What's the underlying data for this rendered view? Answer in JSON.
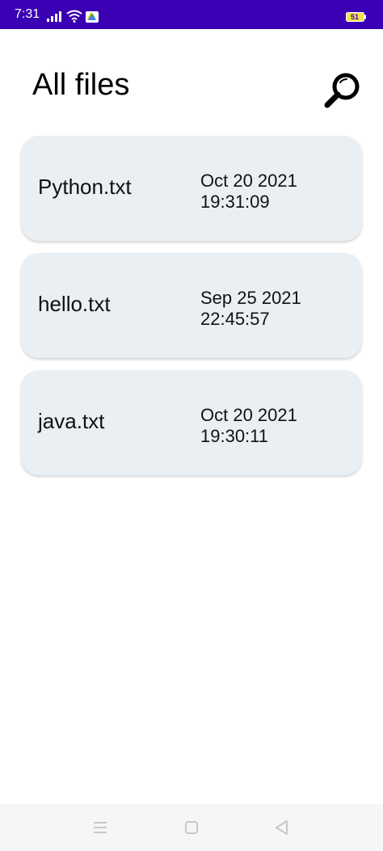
{
  "status_bar": {
    "time": "7:31",
    "battery": "51",
    "icons": [
      "signal-icon",
      "wifi-icon",
      "drive-icon",
      "battery-icon"
    ],
    "background": "#3b00b3"
  },
  "header": {
    "title": "All files",
    "search_icon": "search-icon"
  },
  "files": [
    {
      "name": "Python.txt",
      "date": "Oct 20 2021",
      "time": "19:31:09"
    },
    {
      "name": "hello.txt",
      "date": "Sep 25 2021",
      "time": "22:45:57"
    },
    {
      "name": "java.txt",
      "date": "Oct 20 2021",
      "time": "19:30:11"
    }
  ],
  "nav_bar": {
    "icons": [
      "menu-icon",
      "home-icon",
      "back-icon"
    ]
  },
  "colors": {
    "accent": "#3b00b3",
    "card_background": "#eaeff3"
  }
}
